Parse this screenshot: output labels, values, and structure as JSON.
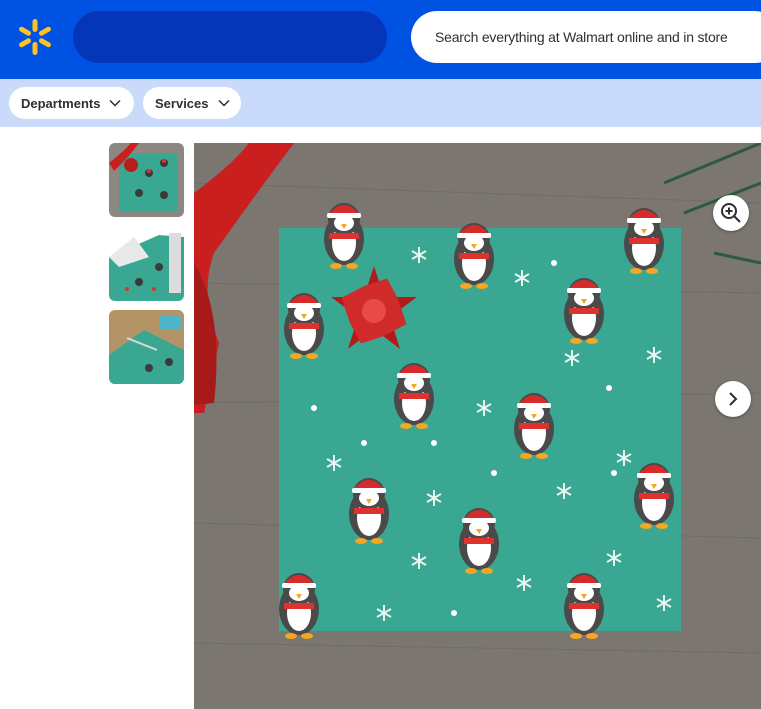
{
  "header": {
    "logo_icon": "walmart-spark-icon",
    "search_placeholder": "Search everything at Walmart online and in store"
  },
  "subnav": {
    "departments_label": "Departments",
    "services_label": "Services"
  },
  "gallery": {
    "thumbnails": [
      {
        "icon": "wrapping-paper-gift-thumbnail"
      },
      {
        "icon": "wrapping-paper-roll-thumbnail"
      },
      {
        "icon": "wrapping-paper-scissors-thumbnail"
      }
    ],
    "main_image_icon": "penguin-christmas-wrapping-paper-image",
    "zoom_icon": "zoom-in-icon",
    "next_icon": "chevron-right-icon"
  },
  "colors": {
    "brand_blue": "#0053e2",
    "spark_yellow": "#ffc220",
    "subnav_bg": "#c9dafb",
    "paper_teal": "#3aa792"
  }
}
